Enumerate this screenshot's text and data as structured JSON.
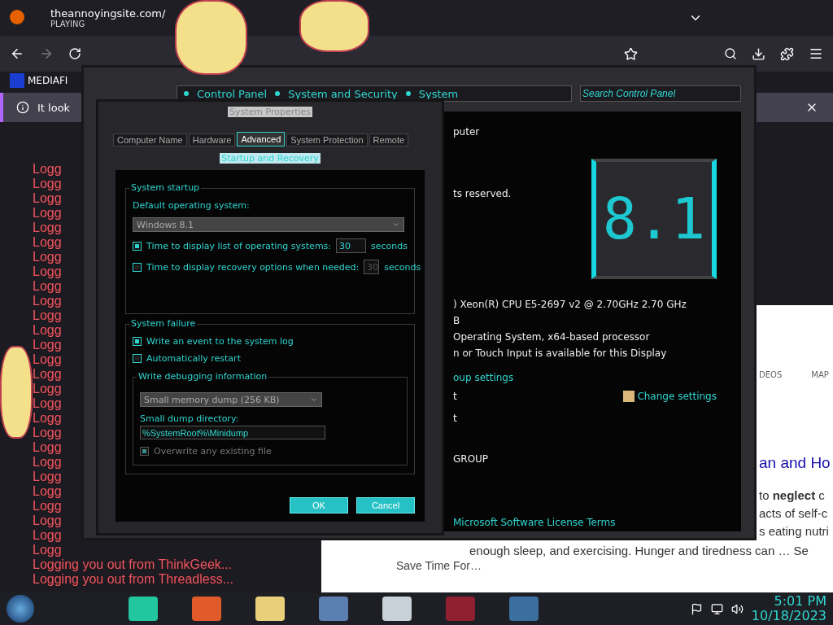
{
  "browser": {
    "tab": {
      "title": "theannoyingsite.com/",
      "status": "PLAYING"
    },
    "bookmark": "MEDIAFI",
    "notice": "It look",
    "log_lines": [
      "Logg",
      "Logg",
      "Logg",
      "Logg",
      "Logg",
      "Logg",
      "Logg",
      "Logg",
      "Logg",
      "Logg",
      "Logg",
      "Logg",
      "Logg",
      "Logg",
      "Logg",
      "Logg",
      "Logg",
      "Logg",
      "Logg",
      "Logg",
      "Logg",
      "Logg",
      "Logg",
      "Logg",
      "Logg",
      "Logg",
      "Logg",
      "Logging you out from ThinkGeek...",
      "Logging you out from Threadless..."
    ],
    "page": {
      "tabs": [
        "DEOS",
        "MAP"
      ],
      "headline": "an and Ho",
      "snippet_lines": [
        "to **neglect** c",
        "acts of self-c",
        "s eating nutri"
      ],
      "snippet_tail": "enough sleep, and exercising. Hunger and tiredness can … Se",
      "side_link": "Save Time For…"
    }
  },
  "control_panel": {
    "breadcrumb": [
      "Control Panel",
      "System and Security",
      "System"
    ],
    "search": {
      "placeholder": "Search Control Panel"
    },
    "top_lines": [
      "puter",
      "ts reserved."
    ],
    "logo": "8.1",
    "specs": [
      ") Xeon(R) CPU E5-2697 v2 @ 2.70GHz   2.70 GHz",
      "B",
      "Operating System, x64-based processor",
      "n or Touch Input is available for this Display"
    ],
    "settings_heading": "oup settings",
    "settings_rows": [
      {
        "value": "t",
        "link": "Change settings"
      },
      {
        "value": "t"
      },
      {
        "value": "GROUP"
      }
    ],
    "license_link": "Microsoft Software License Terms"
  },
  "dialog": {
    "title": "System Properties",
    "tabs": [
      {
        "label": "Computer Name",
        "selected": false
      },
      {
        "label": "Hardware",
        "selected": false
      },
      {
        "label": "Advanced",
        "selected": true
      },
      {
        "label": "System Protection",
        "selected": false
      },
      {
        "label": "Remote",
        "selected": false
      }
    ],
    "subtitle": "Startup and Recovery",
    "startup": {
      "legend": "System startup",
      "os_label": "Default operating system:",
      "os_value": "Windows 8.1",
      "rows": [
        {
          "label": "Time to display list of operating systems:",
          "checked": true,
          "value": "30",
          "unit": "seconds"
        },
        {
          "label": "Time to display recovery options when needed:",
          "checked": false,
          "value": "30",
          "unit": "seconds"
        }
      ]
    },
    "failure": {
      "legend": "System failure",
      "options": [
        {
          "label": "Write an event to the system log",
          "checked": true
        },
        {
          "label": "Automatically restart",
          "checked": false
        }
      ],
      "debug": {
        "legend": "Write debugging information",
        "dump_type": "Small memory dump (256 KB)",
        "dir_label": "Small dump directory:",
        "dir_value": "%SystemRoot%\\Minidump",
        "overwrite": {
          "label": "Overwrite any existing file",
          "checked": true,
          "disabled": true
        }
      }
    },
    "buttons": [
      "OK",
      "Cancel"
    ]
  },
  "taskbar": {
    "time": "5:01 PM",
    "date": "10/18/2023"
  }
}
